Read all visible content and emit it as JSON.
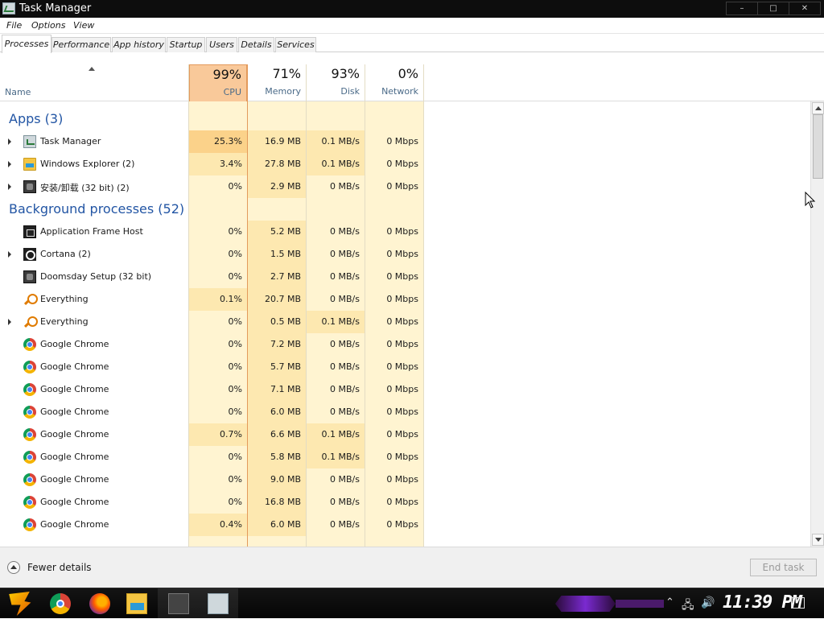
{
  "window": {
    "title": "Task Manager",
    "btn_min": "–",
    "btn_max": "□",
    "btn_close": "✕"
  },
  "menu": {
    "file": "File",
    "options": "Options",
    "view": "View"
  },
  "tabs": [
    "Processes",
    "Performance",
    "App history",
    "Startup",
    "Users",
    "Details",
    "Services"
  ],
  "columns": {
    "name": "Name",
    "cpu": {
      "pct": "99%",
      "label": "CPU"
    },
    "memory": {
      "pct": "71%",
      "label": "Memory"
    },
    "disk": {
      "pct": "93%",
      "label": "Disk"
    },
    "network": {
      "pct": "0%",
      "label": "Network"
    }
  },
  "groups": {
    "apps": "Apps (3)",
    "background": "Background processes (52)"
  },
  "apps": [
    {
      "name": "Task Manager",
      "icon": "task-manager-icon",
      "expand": true,
      "cpu": "25.3%",
      "mem": "16.9 MB",
      "disk": "0.1 MB/s",
      "net": "0 Mbps"
    },
    {
      "name": "Windows Explorer (2)",
      "icon": "folder-icon",
      "expand": true,
      "cpu": "3.4%",
      "mem": "27.8 MB",
      "disk": "0.1 MB/s",
      "net": "0 Mbps"
    },
    {
      "name": "安装/卸载 (32 bit) (2)",
      "icon": "installer-icon",
      "expand": true,
      "cpu": "0%",
      "mem": "2.9 MB",
      "disk": "0 MB/s",
      "net": "0 Mbps"
    }
  ],
  "background": [
    {
      "name": "Application Frame Host",
      "icon": "app-frame-host-icon",
      "expand": false,
      "cpu": "0%",
      "mem": "5.2 MB",
      "disk": "0 MB/s",
      "net": "0 Mbps"
    },
    {
      "name": "Cortana (2)",
      "icon": "cortana-icon",
      "expand": true,
      "cpu": "0%",
      "mem": "1.5 MB",
      "disk": "0 MB/s",
      "net": "0 Mbps"
    },
    {
      "name": "Doomsday Setup (32 bit)",
      "icon": "installer-icon",
      "expand": false,
      "cpu": "0%",
      "mem": "2.7 MB",
      "disk": "0 MB/s",
      "net": "0 Mbps"
    },
    {
      "name": "Everything",
      "icon": "everything-icon",
      "expand": false,
      "cpu": "0.1%",
      "mem": "20.7 MB",
      "disk": "0 MB/s",
      "net": "0 Mbps"
    },
    {
      "name": "Everything",
      "icon": "everything-icon",
      "expand": true,
      "cpu": "0%",
      "mem": "0.5 MB",
      "disk": "0.1 MB/s",
      "net": "0 Mbps"
    },
    {
      "name": "Google Chrome",
      "icon": "chrome-icon",
      "expand": false,
      "cpu": "0%",
      "mem": "7.2 MB",
      "disk": "0 MB/s",
      "net": "0 Mbps"
    },
    {
      "name": "Google Chrome",
      "icon": "chrome-icon",
      "expand": false,
      "cpu": "0%",
      "mem": "5.7 MB",
      "disk": "0 MB/s",
      "net": "0 Mbps"
    },
    {
      "name": "Google Chrome",
      "icon": "chrome-icon",
      "expand": false,
      "cpu": "0%",
      "mem": "7.1 MB",
      "disk": "0 MB/s",
      "net": "0 Mbps"
    },
    {
      "name": "Google Chrome",
      "icon": "chrome-icon",
      "expand": false,
      "cpu": "0%",
      "mem": "6.0 MB",
      "disk": "0 MB/s",
      "net": "0 Mbps"
    },
    {
      "name": "Google Chrome",
      "icon": "chrome-icon",
      "expand": false,
      "cpu": "0.7%",
      "mem": "6.6 MB",
      "disk": "0.1 MB/s",
      "net": "0 Mbps"
    },
    {
      "name": "Google Chrome",
      "icon": "chrome-icon",
      "expand": false,
      "cpu": "0%",
      "mem": "5.8 MB",
      "disk": "0.1 MB/s",
      "net": "0 Mbps"
    },
    {
      "name": "Google Chrome",
      "icon": "chrome-icon",
      "expand": false,
      "cpu": "0%",
      "mem": "9.0 MB",
      "disk": "0 MB/s",
      "net": "0 Mbps"
    },
    {
      "name": "Google Chrome",
      "icon": "chrome-icon",
      "expand": false,
      "cpu": "0%",
      "mem": "16.8 MB",
      "disk": "0 MB/s",
      "net": "0 Mbps"
    },
    {
      "name": "Google Chrome",
      "icon": "chrome-icon",
      "expand": false,
      "cpu": "0.4%",
      "mem": "6.0 MB",
      "disk": "0 MB/s",
      "net": "0 Mbps"
    }
  ],
  "footer": {
    "fewer_details": "Fewer details",
    "end_task": "End task"
  },
  "taskbar": {
    "apps": [
      "start-icon",
      "chrome-icon",
      "firefox-icon",
      "file-explorer-icon",
      "installer-icon",
      "task-manager-icon"
    ],
    "clock": "11:39 PM",
    "tray_icons": [
      "chevron-up-icon",
      "network-icon",
      "volume-icon",
      "notification-icon"
    ]
  },
  "colors": {
    "accent_blue": "#2255a4",
    "cpu_header_hot": "#f9c99a",
    "cell_hot": "#fbd28a",
    "cell_warm": "#fde8b0",
    "cell_light": "#fff4d1",
    "taskbar": "#0a0a0a"
  }
}
